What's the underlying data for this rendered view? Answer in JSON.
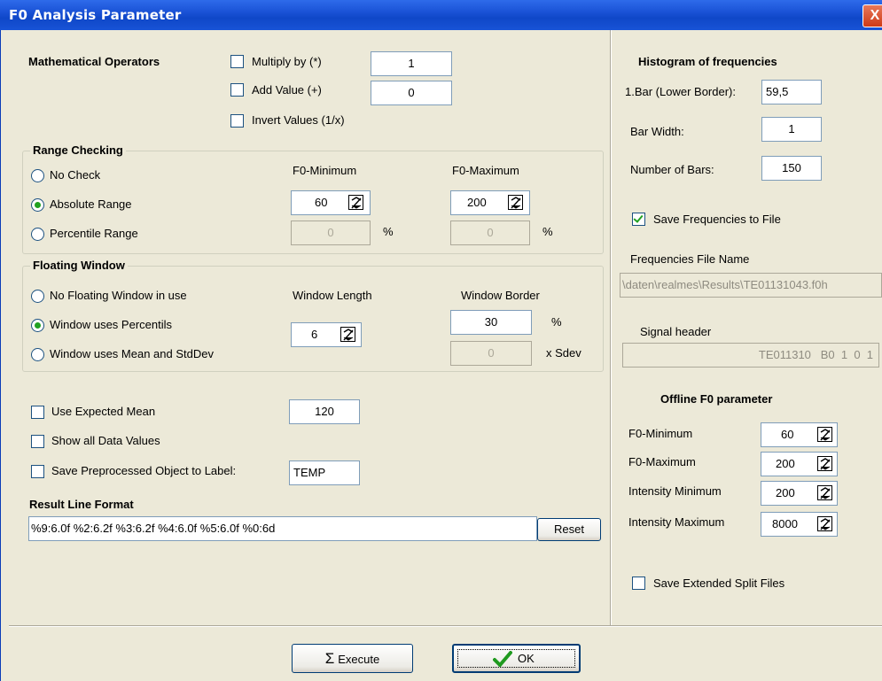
{
  "window": {
    "title": "F0 Analysis Parameter",
    "close_symbol": "X"
  },
  "math": {
    "heading": "Mathematical Operators",
    "multiply_label": "Multiply by (*)",
    "multiply_value": "1",
    "add_label": "Add Value (+)",
    "add_value": "0",
    "invert_label": "Invert Values (1/x)"
  },
  "range": {
    "heading": "Range Checking",
    "no_check": "No Check",
    "absolute": "Absolute Range",
    "percentile": "Percentile Range",
    "min_header": "F0-Minimum",
    "max_header": "F0-Maximum",
    "abs_min": "60",
    "abs_max": "200",
    "pct_min": "0",
    "pct_max": "0",
    "pct_unit": "%",
    "selected": "absolute"
  },
  "floating": {
    "heading": "Floating Window",
    "no_window": "No Floating Window in use",
    "percentils": "Window uses Percentils",
    "mean_std": "Window uses Mean and StdDev",
    "length_header": "Window Length",
    "border_header": "Window Border",
    "length_value": "6",
    "border_pct": "30",
    "border_sdev": "0",
    "pct_unit": "%",
    "sdev_unit": "x Sdev",
    "selected": "percentils"
  },
  "options": {
    "expected_mean_label": "Use Expected Mean",
    "expected_mean_value": "120",
    "show_all_label": "Show all Data Values",
    "save_preproc_label": "Save Preprocessed Object to Label:",
    "save_preproc_value": "TEMP"
  },
  "result": {
    "heading": "Result Line Format",
    "format": "%9:6.0f %2:6.2f %3:6.2f %4:6.0f %5:6.0f %0:6d",
    "reset_label": "Reset"
  },
  "histogram": {
    "heading": "Histogram of frequencies",
    "lower_border_label": "1.Bar (Lower Border):",
    "lower_border_value": "59,5",
    "bar_width_label": "Bar Width:",
    "bar_width_value": "1",
    "num_bars_label": "Number of Bars:",
    "num_bars_value": "150",
    "save_freq_label": "Save Frequencies to File",
    "file_name_label": "Frequencies File Name",
    "file_name_value": "\\daten\\realmes\\Results\\TE01131043.f0h",
    "signal_header_label": "Signal header",
    "signal_header_value": "TE011310   B0  1  0  1"
  },
  "offline": {
    "heading": "Offline F0 parameter",
    "f0_min_label": "F0-Minimum",
    "f0_min_value": "60",
    "f0_max_label": "F0-Maximum",
    "f0_max_value": "200",
    "int_min_label": "Intensity Minimum",
    "int_min_value": "200",
    "int_max_label": "Intensity Maximum",
    "int_max_value": "8000",
    "save_split_label": "Save Extended Split Files"
  },
  "buttons": {
    "execute_symbol": "Σ",
    "execute_label": "Execute",
    "ok_label": "OK"
  },
  "colors": {
    "titlebar": "#1A52D6",
    "dialog_bg": "#ECE9D8",
    "check_green": "#21A121"
  }
}
